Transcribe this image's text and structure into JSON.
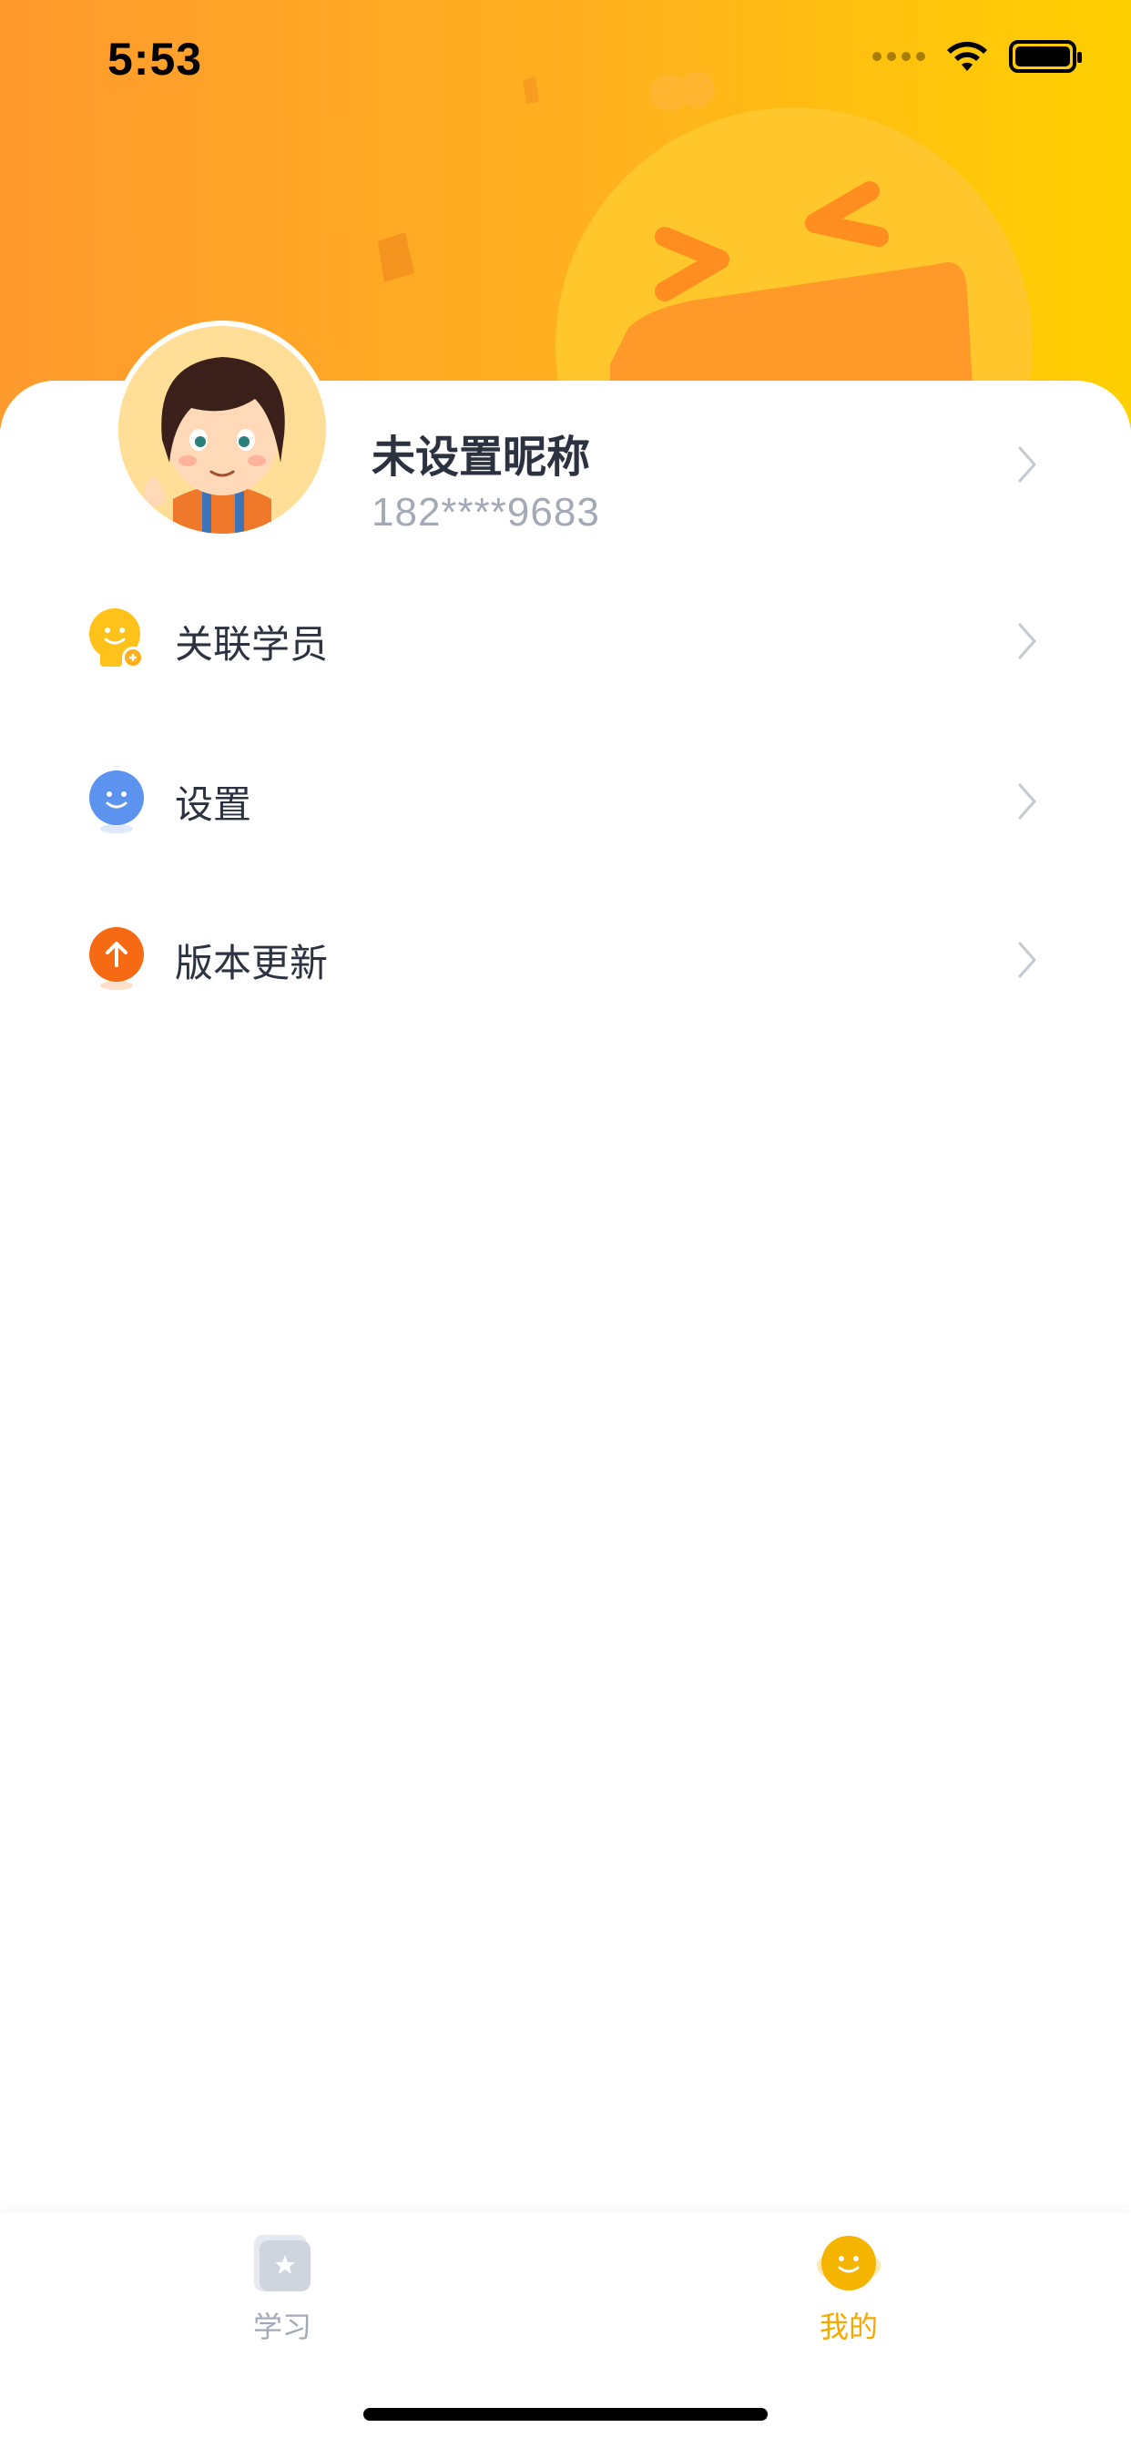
{
  "status_bar": {
    "time": "5:53"
  },
  "profile": {
    "name": "未设置昵称",
    "phone": "182****9683"
  },
  "menu": [
    {
      "label": "关联学员",
      "icon": "link-student-icon"
    },
    {
      "label": "设置",
      "icon": "settings-icon"
    },
    {
      "label": "版本更新",
      "icon": "update-icon"
    }
  ],
  "tabbar": {
    "items": [
      {
        "label": "学习",
        "icon": "study-icon",
        "active": false
      },
      {
        "label": "我的",
        "icon": "mine-icon",
        "active": true
      }
    ]
  },
  "colors": {
    "header_start": "#ff9a2e",
    "header_end": "#ffd000",
    "accent": "#f5a800",
    "inactive": "#a3a9b5"
  }
}
